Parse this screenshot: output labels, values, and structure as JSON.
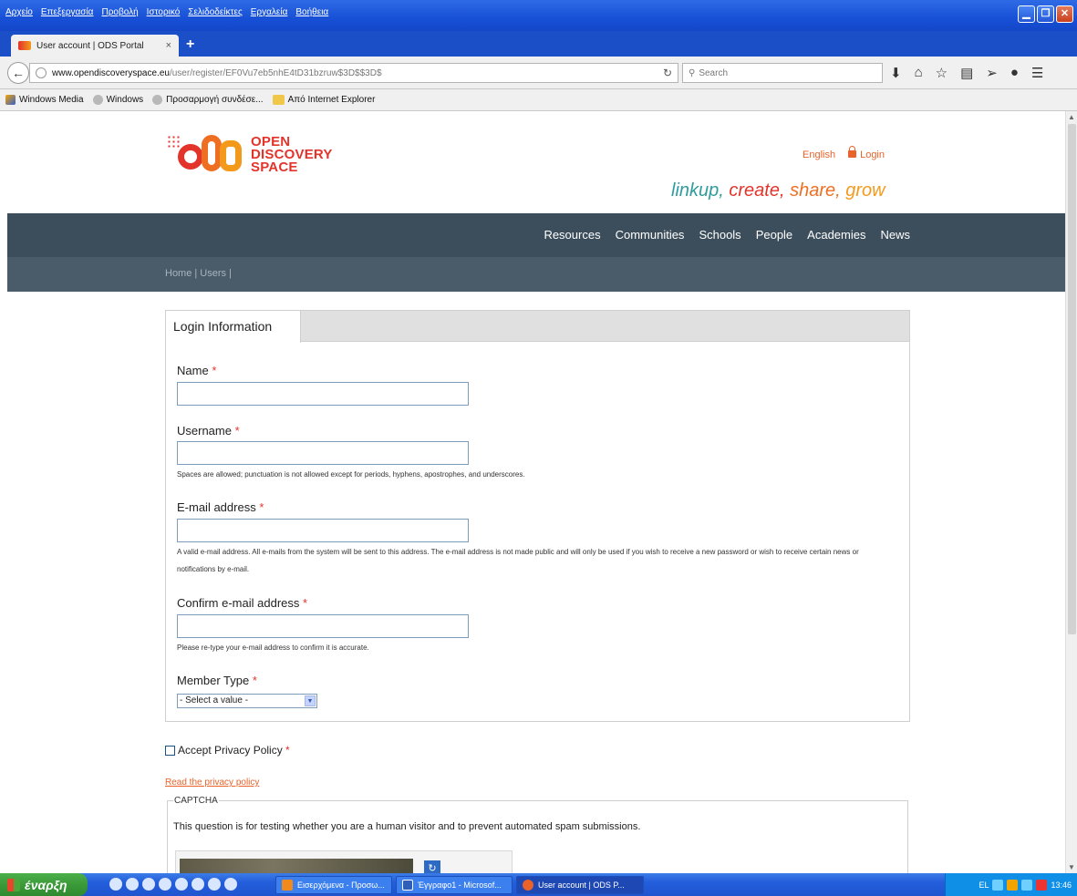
{
  "window": {
    "menu": [
      "Αρχείο",
      "Επεξεργασία",
      "Προβολή",
      "Ιστορικό",
      "Σελιδοδείκτες",
      "Εργαλεία",
      "Βοήθεια"
    ]
  },
  "tab": {
    "title": "User account | ODS Portal",
    "close": "×",
    "new": "+"
  },
  "address": {
    "host": "www.opendiscoveryspace.eu",
    "path": "/user/register/EF0Vu7eb5nhE4tD31bzruw$3D$$3D$",
    "search_placeholder": "Search"
  },
  "bookmarks": [
    "Windows Media",
    "Windows",
    "Προσαρμογή συνδέσε...",
    "Από Internet Explorer"
  ],
  "site": {
    "logo_lines": [
      "OPEN",
      "DISCOVERY",
      "SPACE"
    ],
    "language": "English",
    "login": "Login",
    "tagline": [
      "linkup,",
      "create,",
      "share,",
      "grow"
    ],
    "nav": [
      "Resources",
      "Communities",
      "Schools",
      "People",
      "Academies",
      "News"
    ],
    "breadcrumb": "Home | Users |"
  },
  "form": {
    "tab_label": "Login Information",
    "required_mark": "*",
    "name_label": "Name",
    "username_label": "Username",
    "username_help": "Spaces are allowed; punctuation is not allowed except for periods, hyphens, apostrophes, and underscores.",
    "email_label": "E-mail address",
    "email_help": "A valid e-mail address. All e-mails from the system will be sent to this address. The e-mail address is not made public and will only be used if you wish to receive a new password or wish to receive certain news or notifications by e-mail.",
    "confirm_label": "Confirm e-mail address",
    "confirm_help": "Please re-type your e-mail address to confirm it is accurate.",
    "member_label": "Member Type",
    "member_selected": "- Select a value -",
    "privacy_label": "Accept Privacy Policy",
    "privacy_link": "Read the privacy policy",
    "captcha_legend": "CAPTCHA",
    "captcha_desc": "This question is for testing whether you are a human visitor and to prevent automated spam submissions."
  },
  "taskbar": {
    "start": "έναρξη",
    "tasks": [
      "Εισερχόμενα - Προσω...",
      "Έγγραφο1 - Microsof...",
      "User account | ODS P..."
    ],
    "lang": "EL",
    "time": "13:46"
  }
}
